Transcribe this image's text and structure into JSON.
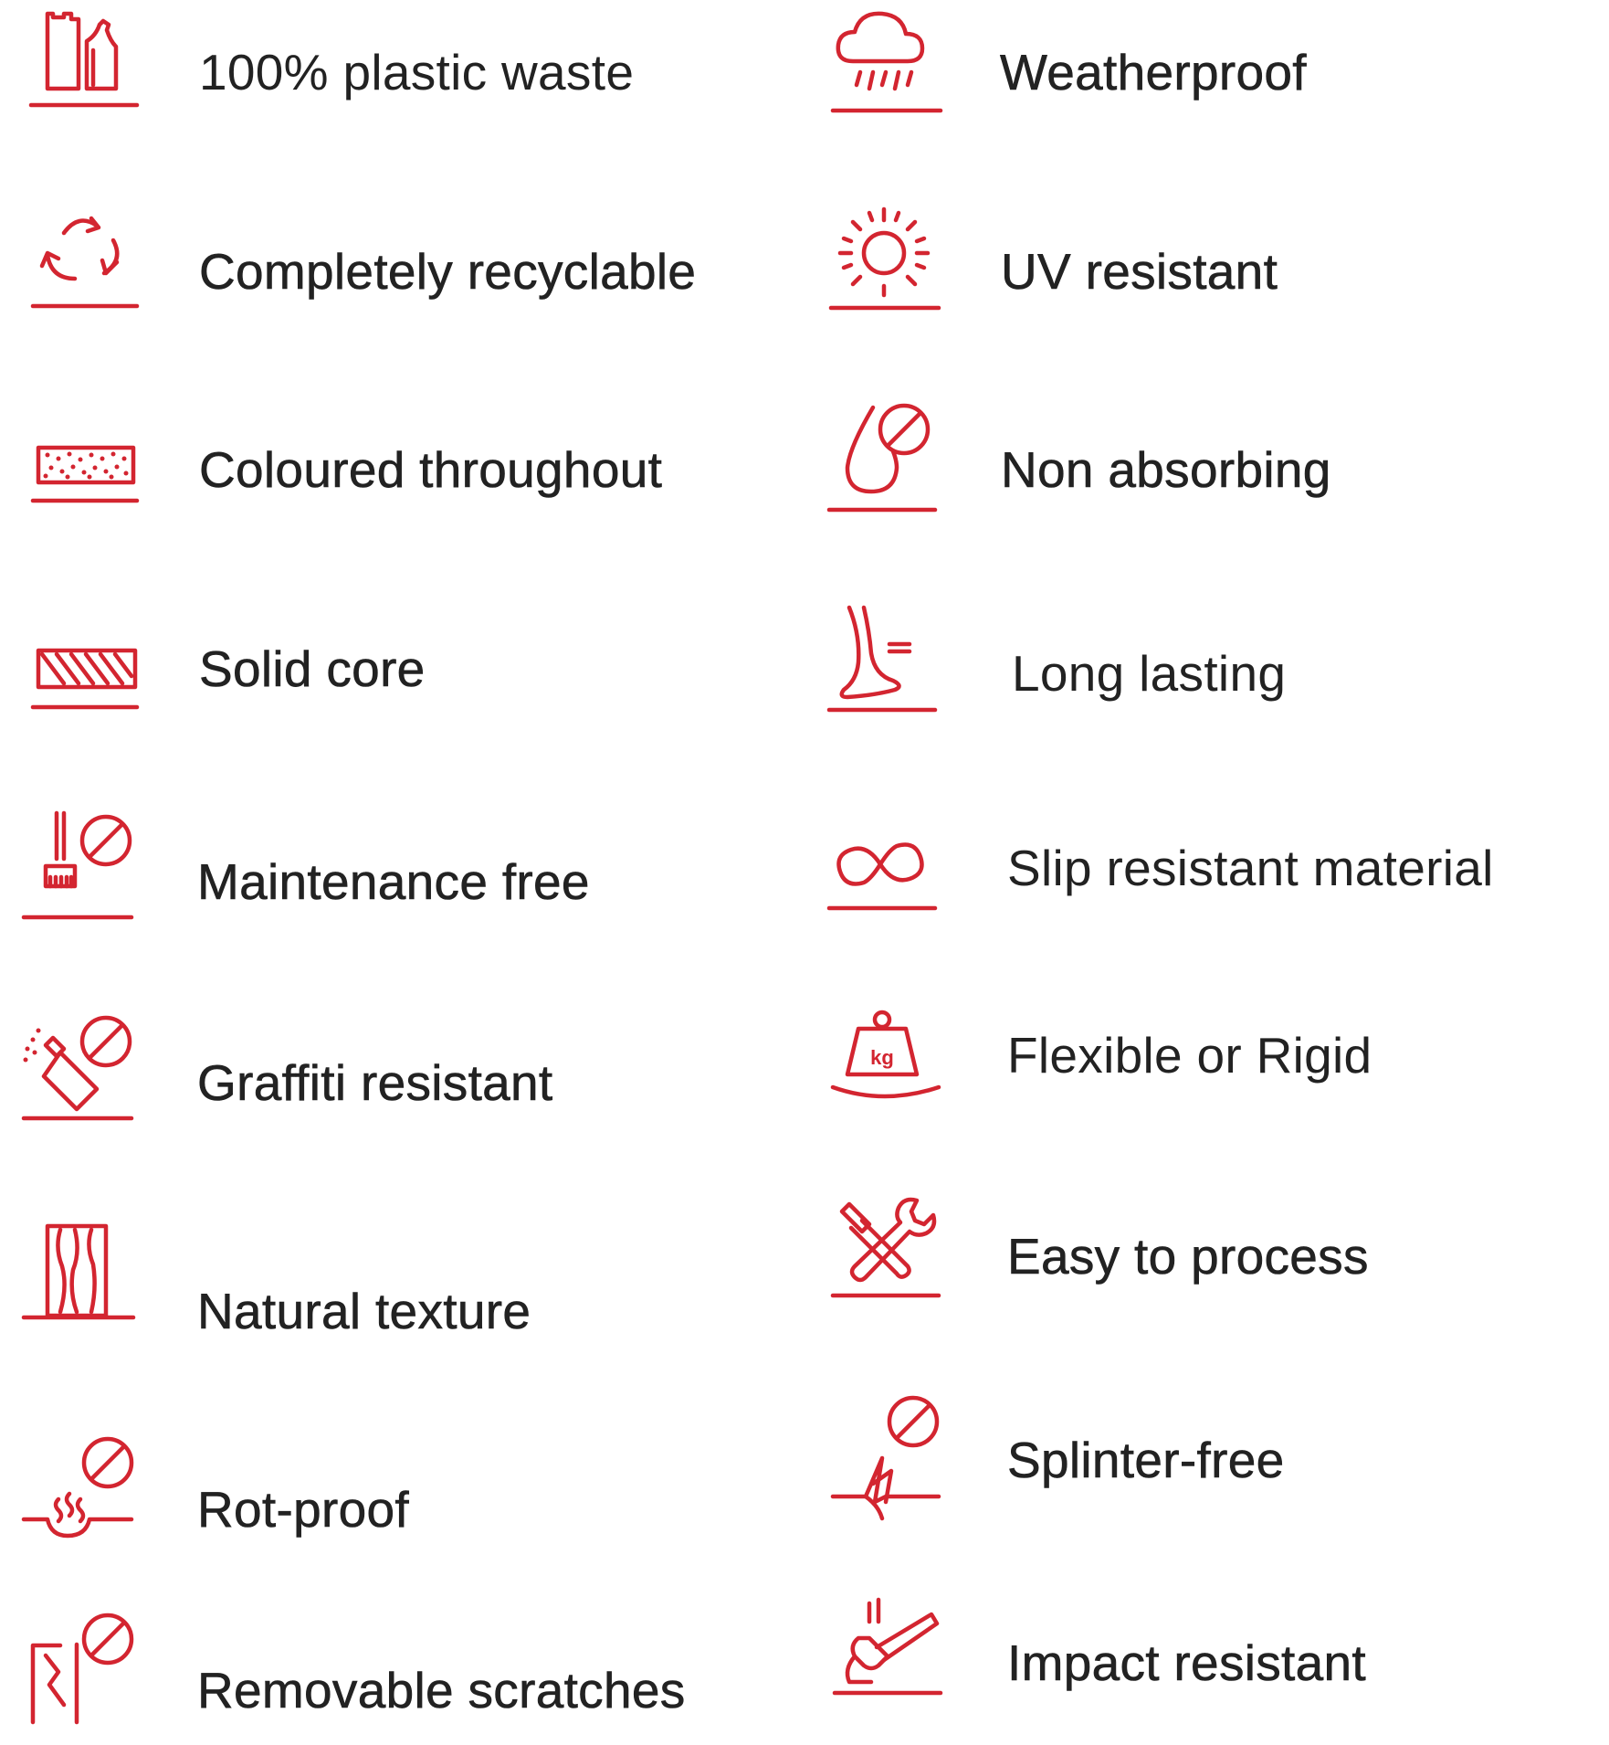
{
  "accent_color": "#d32530",
  "text_color": "#222222",
  "left_column": [
    {
      "icon": "plastic-bottles-icon",
      "label": "100% plastic waste"
    },
    {
      "icon": "recycle-icon",
      "label": "Completely recyclable"
    },
    {
      "icon": "speckled-board-icon",
      "label": "Coloured throughout"
    },
    {
      "icon": "hatched-board-icon",
      "label": "Solid core"
    },
    {
      "icon": "broom-prohibited-icon",
      "label": "Maintenance free"
    },
    {
      "icon": "spray-can-prohibited-icon",
      "label": "Graffiti resistant"
    },
    {
      "icon": "wood-grain-icon",
      "label": "Natural texture"
    },
    {
      "icon": "rot-prohibited-icon",
      "label": "Rot-proof"
    },
    {
      "icon": "scratch-prohibited-icon",
      "label": "Removable scratches"
    }
  ],
  "right_column": [
    {
      "icon": "rain-cloud-icon",
      "label": "Weatherproof"
    },
    {
      "icon": "sun-icon",
      "label": "UV resistant"
    },
    {
      "icon": "water-drop-prohibited-icon",
      "label": "Non absorbing"
    },
    {
      "icon": "foot-step-icon",
      "label": "Long lasting"
    },
    {
      "icon": "infinity-icon",
      "label": "Slip resistant material"
    },
    {
      "icon": "kg-weight-icon",
      "label": "Flexible or Rigid"
    },
    {
      "icon": "hammer-wrench-icon",
      "label": "Easy to process"
    },
    {
      "icon": "splinter-prohibited-icon",
      "label": "Splinter-free"
    },
    {
      "icon": "hammer-impact-icon",
      "label": "Impact resistant"
    }
  ]
}
